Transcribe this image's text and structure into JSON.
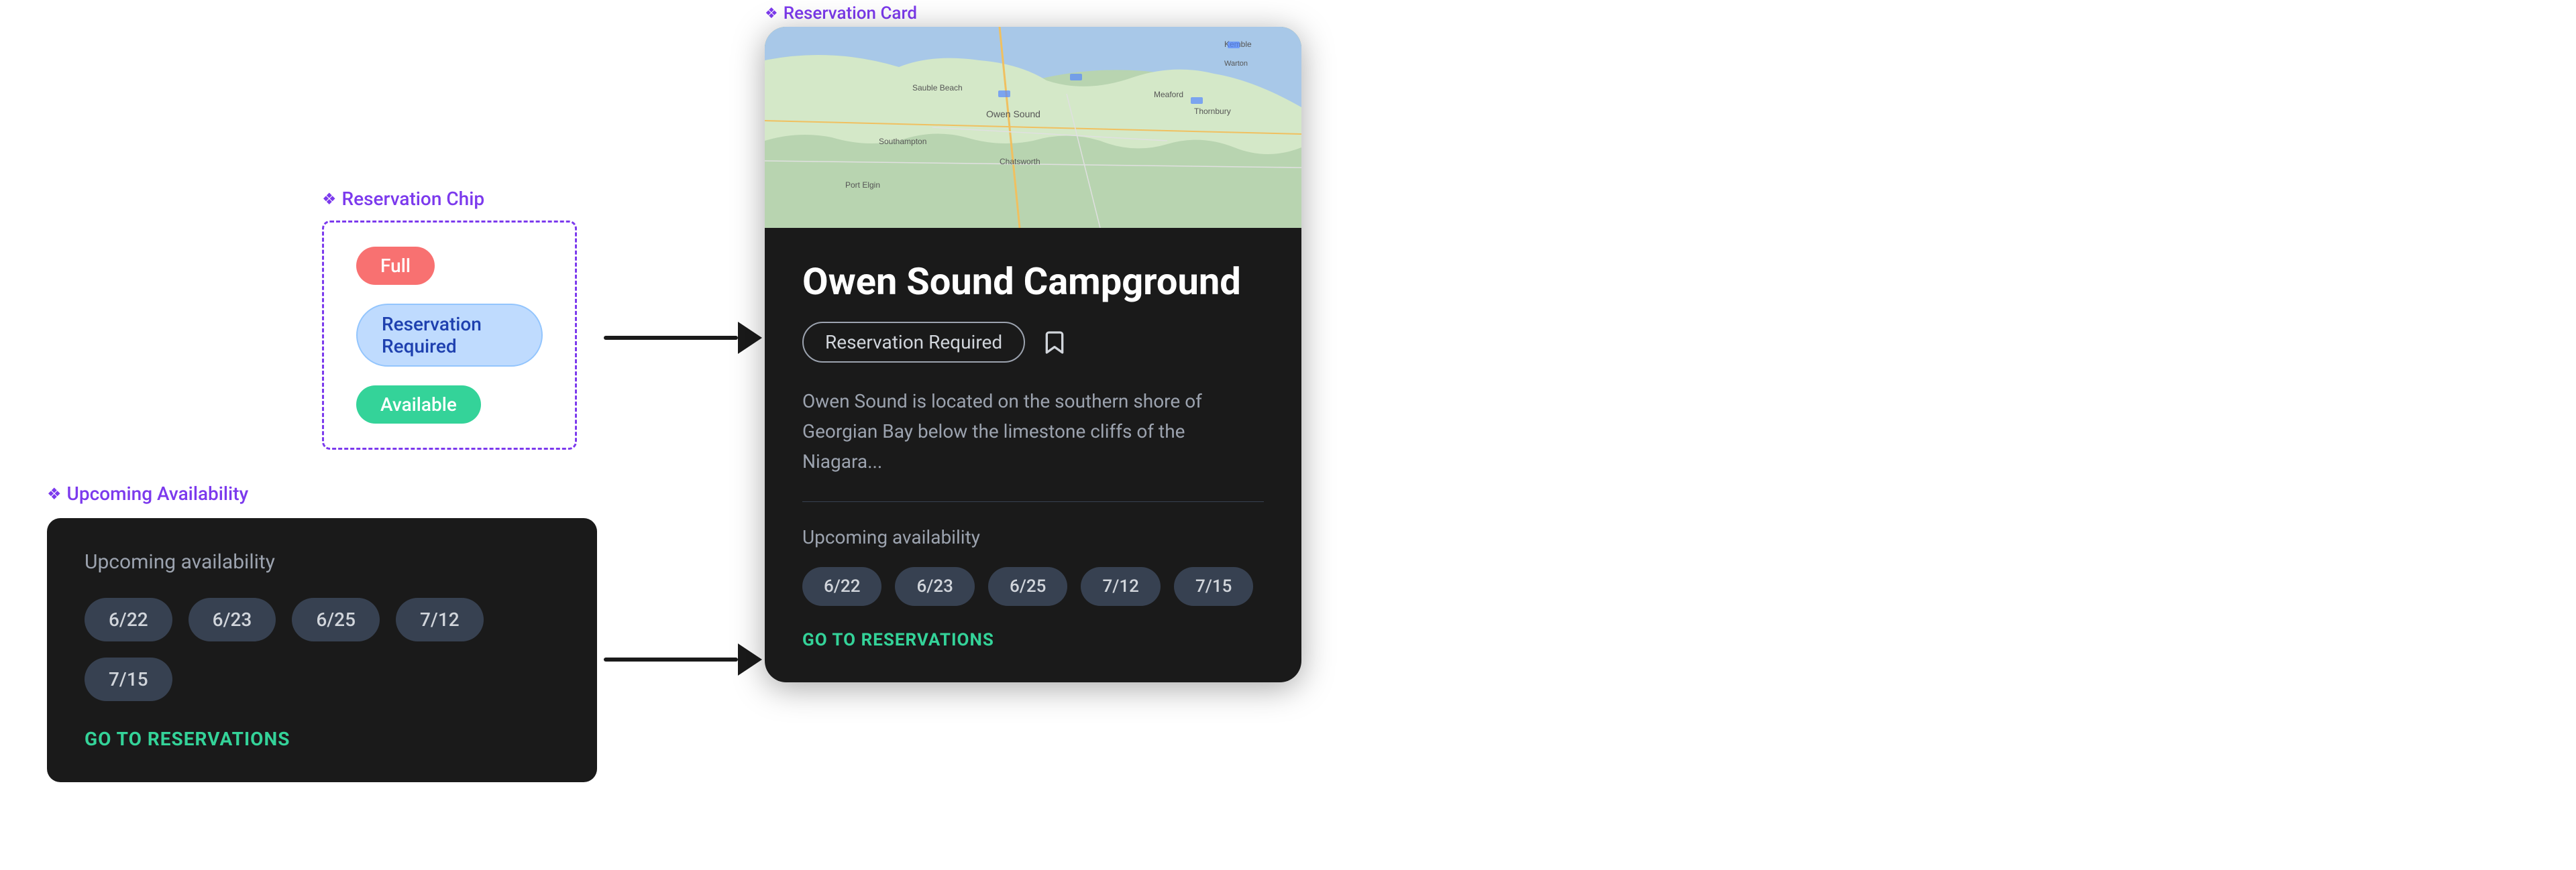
{
  "reservationChip": {
    "label": "Reservation Chip",
    "chips": [
      {
        "text": "Full",
        "type": "full"
      },
      {
        "text": "Reservation Required",
        "type": "reservation"
      },
      {
        "text": "Available",
        "type": "available"
      }
    ]
  },
  "upcomingAvailability": {
    "sectionLabel": "Upcoming Availability",
    "cardTitle": "Upcoming availability",
    "dates": [
      "6/22",
      "6/23",
      "6/25",
      "7/12",
      "7/15"
    ],
    "goToReservations": "GO TO RESERVATIONS"
  },
  "reservationCard": {
    "sectionLabel": "Reservation Card",
    "campgroundName": "Owen Sound Campground",
    "chipText": "Reservation Required",
    "description": "Owen Sound is located on the southern shore of Georgian Bay below the limestone cliffs of the Niagara...",
    "upcomingTitle": "Upcoming availability",
    "dates": [
      "6/22",
      "6/23",
      "6/25",
      "7/12",
      "7/15"
    ],
    "goToReservations": "GO TO RESERVATIONS"
  }
}
